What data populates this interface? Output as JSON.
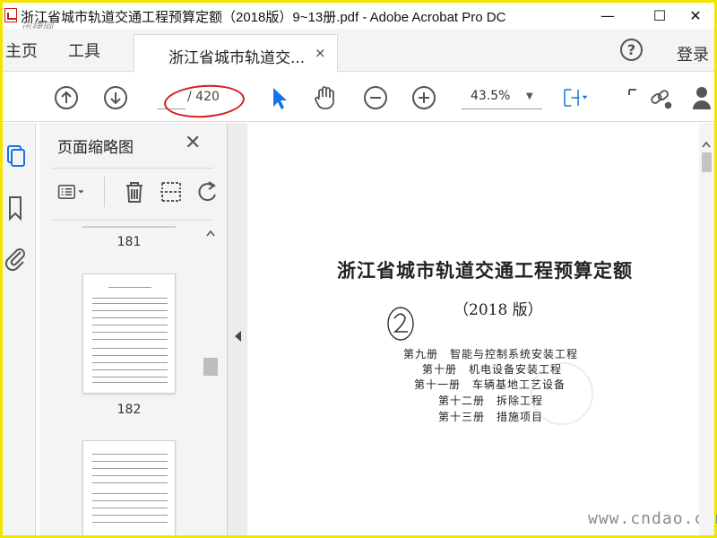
{
  "window": {
    "title": "浙江省城市轨道交通工程预算定额（2018版）9~13册.pdf - Adobe Acrobat Pro DC",
    "watermark_top": "迅捷网",
    "minimize": "—",
    "maximize": "☐",
    "close": "✕"
  },
  "nav": {
    "home": "主页",
    "tools": "工具",
    "doc_tab": "浙江省城市轨道交...",
    "doc_tab_close": "×",
    "help": "?",
    "login": "登录"
  },
  "toolbar": {
    "page_current": "",
    "page_total": "/ 420",
    "zoom": "43.5%",
    "annotation": "red ellipse drawn around page number field",
    "icons": [
      "prev-page-icon",
      "next-page-icon",
      "select-arrow-icon",
      "hand-icon",
      "zoom-out-icon",
      "zoom-in-icon",
      "fit-page-icon",
      "link-tool-icon",
      "share-icon"
    ]
  },
  "panel": {
    "title": "页面缩略图",
    "close": "✕",
    "thumbnails": [
      {
        "label": "181"
      },
      {
        "label": "182"
      }
    ]
  },
  "document": {
    "title": "浙江省城市轨道交通工程预算定额",
    "edition": "（2018 版）",
    "handwritten": "2",
    "volumes": [
      "第九册　智能与控制系统安装工程",
      "第十册　机电设备安装工程",
      "第十一册　车辆基地工艺设备",
      "第十二册　拆除工程",
      "第十三册　措施项目"
    ]
  },
  "footer": {
    "watermark": "www.cndao.com"
  },
  "colors": {
    "border": "#f2e600",
    "accent": "#1473e6",
    "annotation": "#d51c1c"
  }
}
